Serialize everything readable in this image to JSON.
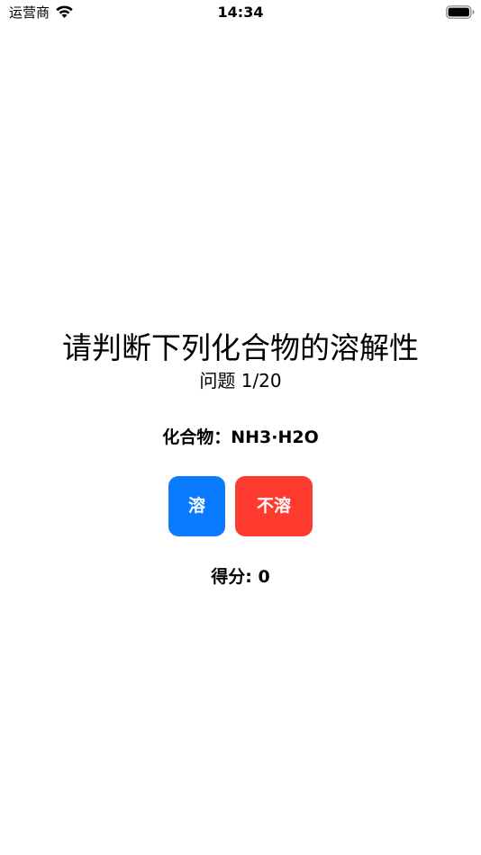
{
  "status_bar": {
    "carrier": "运营商",
    "time": "14:34",
    "wifi_icon": "wifi-icon",
    "battery_icon": "battery-full-icon"
  },
  "quiz": {
    "title": "请判断下列化合物的溶解性",
    "counter": "问题 1/20",
    "compound": "化合物：NH3·H2O",
    "soluble_label": "溶",
    "insoluble_label": "不溶",
    "score": "得分: 0"
  },
  "colors": {
    "soluble_button": "#0a7bff",
    "insoluble_button": "#ff3a2f"
  }
}
